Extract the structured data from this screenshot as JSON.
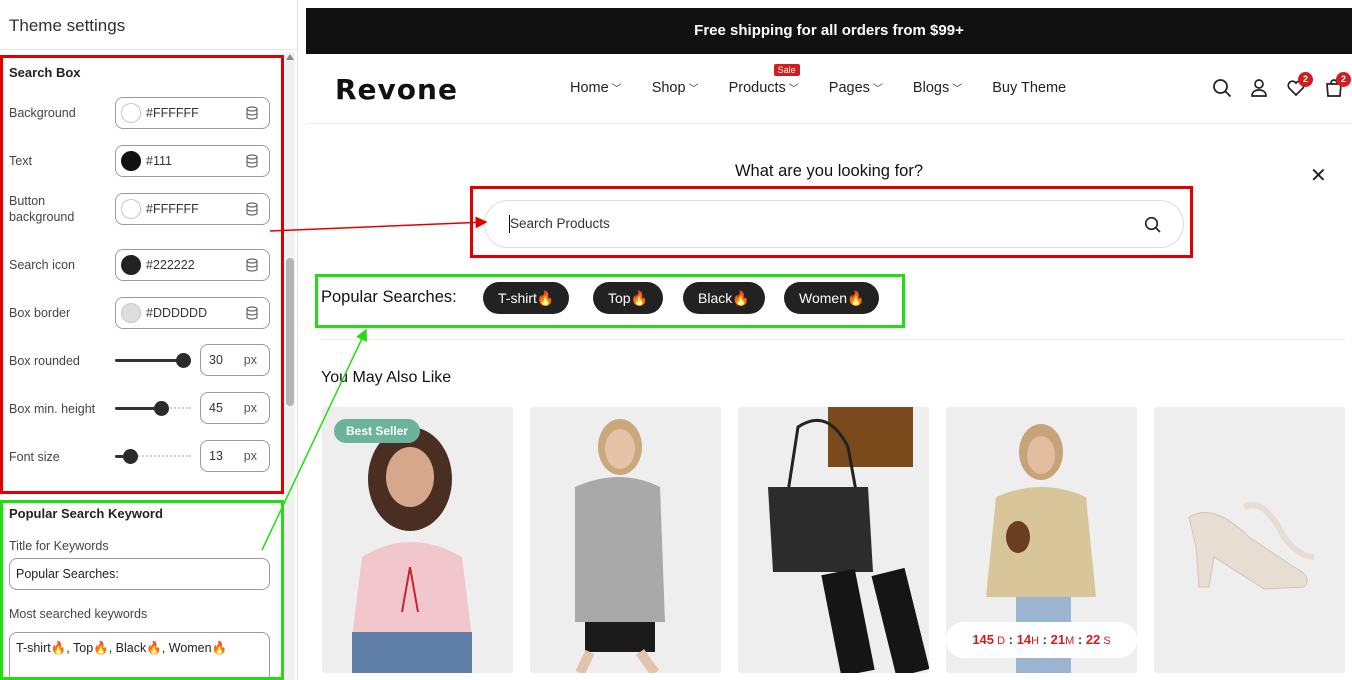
{
  "panel": {
    "title": "Theme settings",
    "search_box": {
      "title": "Search Box",
      "colors": [
        {
          "label": "Background",
          "value": "#FFFFFF",
          "swatch": "#FFFFFF"
        },
        {
          "label": "Text",
          "value": "#111",
          "swatch": "#111111"
        },
        {
          "label": "Button background",
          "value": "#FFFFFF",
          "swatch": "#FFFFFF"
        },
        {
          "label": "Search icon",
          "value": "#222222",
          "swatch": "#222222"
        },
        {
          "label": "Box border",
          "value": "#DDDDDD",
          "swatch": "#DDDDDD"
        }
      ],
      "sliders": [
        {
          "label": "Box rounded",
          "value": "30",
          "unit": "px",
          "level": 0.9
        },
        {
          "label": "Box min. height",
          "value": "45",
          "unit": "px",
          "level": 0.6
        },
        {
          "label": "Font size",
          "value": "13",
          "unit": "px",
          "level": 0.2
        }
      ]
    },
    "keywords": {
      "title": "Popular Search Keyword",
      "title_label": "Title for Keywords",
      "title_value": "Popular Searches:",
      "list_label": "Most searched keywords",
      "list_value": "T-shirt🔥, Top🔥, Black🔥, Women🔥"
    }
  },
  "store": {
    "announcement": "Free shipping for all orders from $99+",
    "logo": "Revone",
    "nav": [
      {
        "label": "Home",
        "dropdown": true
      },
      {
        "label": "Shop",
        "dropdown": true
      },
      {
        "label": "Products",
        "dropdown": true,
        "badge": "Sale"
      },
      {
        "label": "Pages",
        "dropdown": true
      },
      {
        "label": "Blogs",
        "dropdown": true
      },
      {
        "label": "Buy Theme",
        "dropdown": false
      }
    ],
    "wishlist_count": "2",
    "cart_count": "2",
    "search": {
      "heading": "What are you looking for?",
      "placeholder": "Search Products"
    },
    "popular": {
      "title": "Popular Searches:",
      "chips": [
        "T-shirt🔥",
        "Top🔥",
        "Black🔥",
        "Women🔥"
      ]
    },
    "recommend_title": "You May Also Like",
    "products": [
      {
        "badge": "Best Seller"
      },
      {},
      {},
      {
        "countdown": {
          "d": "145",
          "h": "14",
          "m": "21",
          "s": "22"
        }
      },
      {}
    ]
  },
  "colors": {
    "highlight_red": "#e00000",
    "highlight_green": "#22dd11",
    "sale_red": "#d01e1e",
    "badge_green": "#6cb39b"
  }
}
